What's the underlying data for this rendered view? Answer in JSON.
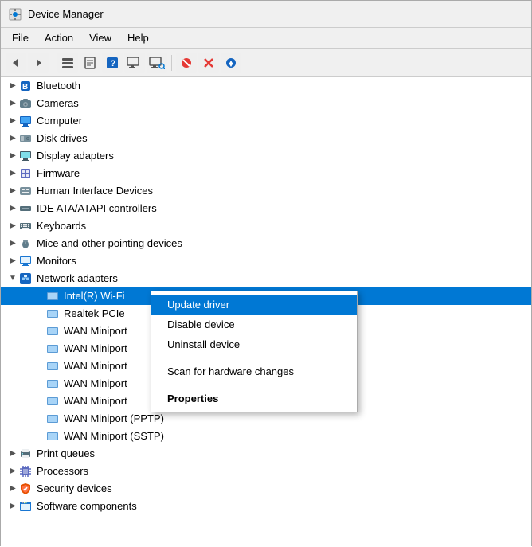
{
  "titleBar": {
    "title": "Device Manager",
    "icon": "⚙"
  },
  "menuBar": {
    "items": [
      "File",
      "Action",
      "View",
      "Help"
    ]
  },
  "toolbar": {
    "buttons": [
      {
        "name": "back",
        "icon": "←",
        "disabled": false
      },
      {
        "name": "forward",
        "icon": "→",
        "disabled": false
      },
      {
        "name": "show-hidden",
        "icon": "☰",
        "disabled": false
      },
      {
        "name": "properties",
        "icon": "📋",
        "disabled": false
      },
      {
        "name": "help",
        "icon": "?",
        "disabled": false
      },
      {
        "name": "monitor",
        "icon": "🖥",
        "disabled": false
      },
      {
        "name": "monitor2",
        "icon": "📺",
        "disabled": false
      },
      {
        "name": "scan",
        "icon": "🔍",
        "disabled": false
      },
      {
        "name": "uninstall",
        "icon": "✖",
        "disabled": false
      },
      {
        "name": "update",
        "icon": "⬇",
        "disabled": false
      }
    ]
  },
  "tree": {
    "items": [
      {
        "id": "bluetooth",
        "label": "Bluetooth",
        "icon": "bluetooth",
        "expanded": false,
        "level": 0
      },
      {
        "id": "cameras",
        "label": "Cameras",
        "icon": "camera",
        "expanded": false,
        "level": 0
      },
      {
        "id": "computer",
        "label": "Computer",
        "icon": "computer",
        "expanded": false,
        "level": 0
      },
      {
        "id": "disk-drives",
        "label": "Disk drives",
        "icon": "disk",
        "expanded": false,
        "level": 0
      },
      {
        "id": "display-adapters",
        "label": "Display adapters",
        "icon": "display",
        "expanded": false,
        "level": 0
      },
      {
        "id": "firmware",
        "label": "Firmware",
        "icon": "firmware",
        "expanded": false,
        "level": 0
      },
      {
        "id": "hid",
        "label": "Human Interface Devices",
        "icon": "hid",
        "expanded": false,
        "level": 0
      },
      {
        "id": "ide",
        "label": "IDE ATA/ATAPI controllers",
        "icon": "ide",
        "expanded": false,
        "level": 0
      },
      {
        "id": "keyboards",
        "label": "Keyboards",
        "icon": "keyboard",
        "expanded": false,
        "level": 0
      },
      {
        "id": "mice",
        "label": "Mice and other pointing devices",
        "icon": "mouse",
        "expanded": false,
        "level": 0
      },
      {
        "id": "monitors",
        "label": "Monitors",
        "icon": "monitor",
        "expanded": false,
        "level": 0
      },
      {
        "id": "network",
        "label": "Network adapters",
        "icon": "network",
        "expanded": true,
        "level": 0
      },
      {
        "id": "intel-wifi",
        "label": "Intel(R) Wi-Fi",
        "icon": "network-card",
        "level": 1,
        "selected": true
      },
      {
        "id": "realtek",
        "label": "Realtek PCIe",
        "icon": "network-card",
        "level": 1
      },
      {
        "id": "wan1",
        "label": "WAN Miniport",
        "icon": "network-card",
        "level": 1
      },
      {
        "id": "wan2",
        "label": "WAN Miniport",
        "icon": "network-card",
        "level": 1
      },
      {
        "id": "wan3",
        "label": "WAN Miniport",
        "icon": "network-card",
        "level": 1
      },
      {
        "id": "wan4",
        "label": "WAN Miniport",
        "icon": "network-card",
        "level": 1
      },
      {
        "id": "wan5",
        "label": "WAN Miniport",
        "icon": "network-card",
        "level": 1
      },
      {
        "id": "wan-pptp",
        "label": "WAN Miniport (PPTP)",
        "icon": "network-card",
        "level": 1
      },
      {
        "id": "wan-sstp",
        "label": "WAN Miniport (SSTP)",
        "icon": "network-card",
        "level": 1
      },
      {
        "id": "print-queues",
        "label": "Print queues",
        "icon": "print",
        "expanded": false,
        "level": 0
      },
      {
        "id": "processors",
        "label": "Processors",
        "icon": "processor",
        "expanded": false,
        "level": 0
      },
      {
        "id": "security",
        "label": "Security devices",
        "icon": "security",
        "expanded": false,
        "level": 0
      },
      {
        "id": "software-components",
        "label": "Software components",
        "icon": "software",
        "expanded": false,
        "level": 0
      }
    ]
  },
  "contextMenu": {
    "items": [
      {
        "id": "update-driver",
        "label": "Update driver",
        "highlighted": true,
        "bold": false
      },
      {
        "id": "disable-device",
        "label": "Disable device",
        "highlighted": false
      },
      {
        "id": "uninstall-device",
        "label": "Uninstall device",
        "highlighted": false
      },
      {
        "id": "sep1",
        "type": "separator"
      },
      {
        "id": "scan",
        "label": "Scan for hardware changes",
        "highlighted": false
      },
      {
        "id": "sep2",
        "type": "separator"
      },
      {
        "id": "properties",
        "label": "Properties",
        "highlighted": false,
        "bold": true
      }
    ]
  }
}
